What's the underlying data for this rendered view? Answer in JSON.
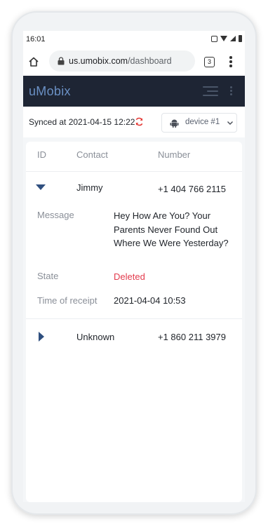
{
  "status_bar": {
    "time": "16:01",
    "icons": [
      "key-icon",
      "wifi-icon",
      "signal-icon",
      "battery-icon"
    ]
  },
  "browser": {
    "url_host": "us.umobix.com",
    "url_path": "/dashboard",
    "tab_count": "3"
  },
  "app": {
    "logo": "uMobix",
    "header_color": "#1e2534"
  },
  "sync": {
    "label": "Synced at 2021-04-15 12:22",
    "device": "device #1"
  },
  "table": {
    "columns": [
      "ID",
      "Contact",
      "Number"
    ],
    "rows": [
      {
        "contact": "Jimmy",
        "number": "+1 404 766 2115",
        "expanded": true,
        "details": {
          "message_label": "Message",
          "message": "Hey How Are You? Your Parents Never Found Out Where We Were Yesterday?",
          "state_label": "State",
          "state": "Deleted",
          "time_label": "Time of receipt",
          "time": "2021-04-04 10:53"
        }
      },
      {
        "contact": "Unknown",
        "number": "+1 860 211 3979",
        "expanded": false
      }
    ]
  },
  "colors": {
    "accent": "#2f4f7f",
    "deleted": "#e33b4d",
    "refresh": "#e53935"
  }
}
